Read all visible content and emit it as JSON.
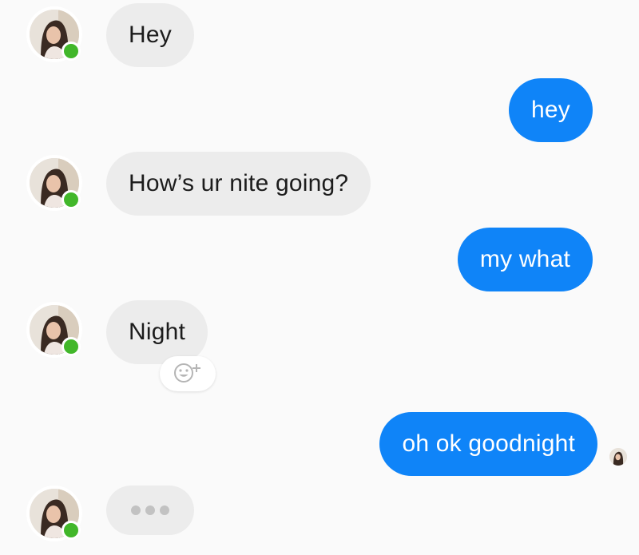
{
  "conversation": {
    "messages": [
      {
        "direction": "incoming",
        "text": "Hey"
      },
      {
        "direction": "outgoing",
        "text": "hey"
      },
      {
        "direction": "incoming",
        "text": "How’s ur nite going?"
      },
      {
        "direction": "outgoing",
        "text": "my what"
      },
      {
        "direction": "incoming",
        "text": "Night"
      },
      {
        "direction": "outgoing",
        "text": "oh ok goodnight"
      }
    ],
    "typing_indicator": true,
    "contact_status": "online",
    "icons": {
      "reaction": "add-reaction-icon",
      "typing": "typing-dots-icon",
      "seen": "seen-avatar-icon"
    }
  },
  "colors": {
    "outgoing_bubble": "#0f84f8",
    "incoming_bubble": "#ececec",
    "online_dot": "#42b72a",
    "background": "#fafafa"
  }
}
